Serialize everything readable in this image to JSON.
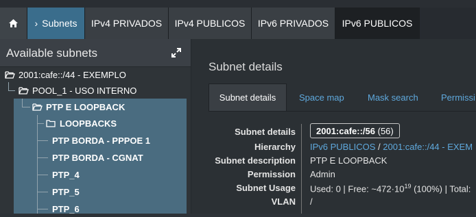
{
  "nav": {
    "home_icon": "home-icon",
    "items": [
      {
        "label": "Subnets"
      },
      {
        "label": "IPv4 PRIVADOS"
      },
      {
        "label": "IPv4 PUBLICOS"
      },
      {
        "label": "IPv6 PRIVADOS"
      },
      {
        "label": "IPv6 PUBLICOS"
      }
    ]
  },
  "sidebar": {
    "title": "Available subnets",
    "tree": [
      {
        "label": "2001:cafe::/44 - EXEMPLO",
        "icon": "folder-open-icon",
        "level": 0
      },
      {
        "label": "POOL_1 - USO INTERNO",
        "icon": "folder-open-icon",
        "level": 1
      },
      {
        "label": "PTP E LOOPBACK",
        "icon": "folder-open-icon",
        "level": 2
      },
      {
        "label": "LOOPBACKS",
        "icon": "folder-icon",
        "level": 3
      },
      {
        "label": "PTP BORDA - PPPOE 1",
        "level": 3
      },
      {
        "label": "PTP BORDA - CGNAT",
        "level": 3
      },
      {
        "label": "PTP_4",
        "level": 3
      },
      {
        "label": "PTP_5",
        "level": 3
      },
      {
        "label": "PTP_6",
        "level": 3
      }
    ]
  },
  "main": {
    "title": "Subnet details",
    "tabs": [
      {
        "label": "Subnet details"
      },
      {
        "label": "Space map"
      },
      {
        "label": "Mask search"
      },
      {
        "label": "Permissi"
      }
    ],
    "details": {
      "subnet_details_label": "Subnet details",
      "subnet_value": "2001:cafe::/56",
      "subnet_count": "(56)",
      "hierarchy_label": "Hierarchy",
      "hierarchy_1": "IPv6 PUBLICOS",
      "hierarchy_sep": "/",
      "hierarchy_2": "2001:cafe::/44 - EXEM",
      "description_label": "Subnet description",
      "description_value": "PTP E LOOPBACK",
      "permission_label": "Permission",
      "permission_value": "Admin",
      "usage_label": "Subnet Usage",
      "usage_prefix": "Used: 0 | Free: ~472·10",
      "usage_exp": "^19",
      "usage_suffix": " (100%) | Total:",
      "vlan_label": "VLAN",
      "vlan_value": "/"
    }
  },
  "colors": {
    "accent": "#3a6d8c",
    "link": "#5fa9dd",
    "selected_tree": "#4a6c80"
  }
}
